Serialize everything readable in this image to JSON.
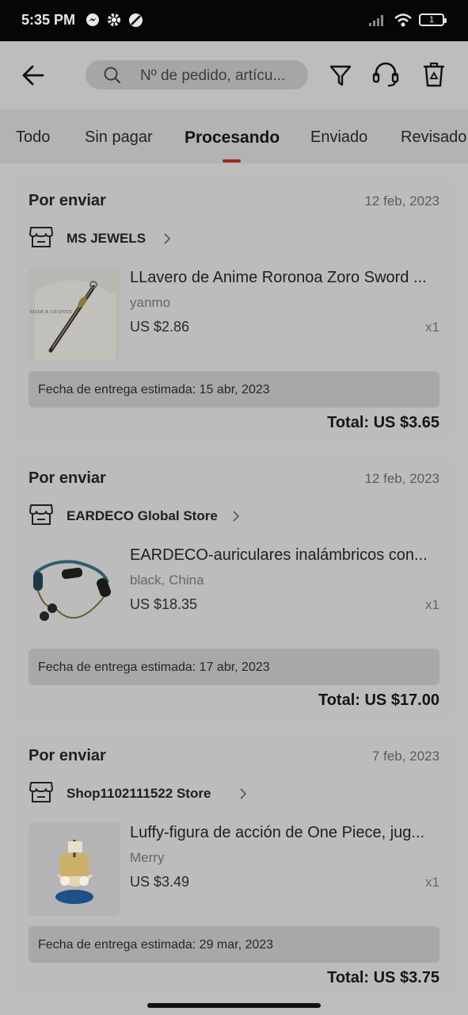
{
  "status_bar": {
    "time": "5:35 PM",
    "battery": "1",
    "icons": [
      "messenger-icon",
      "settings-icon",
      "no-disturb-icon",
      "signal-icon",
      "wifi-icon",
      "battery-icon"
    ]
  },
  "header": {
    "search_placeholder": "Nº de pedido, artícu...",
    "icons": [
      "back-arrow-icon",
      "search-icon",
      "filter-icon",
      "headset-icon",
      "trash-icon"
    ]
  },
  "tabs": [
    {
      "label": "Todo",
      "active": false
    },
    {
      "label": "Sin pagar",
      "active": false
    },
    {
      "label": "Procesando",
      "active": true
    },
    {
      "label": "Enviado",
      "active": false
    },
    {
      "label": "Revisado",
      "active": false
    }
  ],
  "orders": [
    {
      "status": "Por enviar",
      "date": "12 feb, 2023",
      "store": "MS JEWELS",
      "title": "LLavero de Anime Roronoa Zoro Sword ...",
      "variant": "yanmo",
      "price": "US $2.86",
      "qty": "x1",
      "delivery": "Fecha de entrega estimada: 15 abr, 2023",
      "total": "Total: US $3.65"
    },
    {
      "status": "Por enviar",
      "date": "12 feb, 2023",
      "store": "EARDECO Global Store",
      "title": "EARDECO-auriculares inalámbricos con...",
      "variant": "black, China",
      "price": "US $18.35",
      "qty": "x1",
      "delivery": "Fecha de entrega estimada: 17 abr, 2023",
      "total": "Total: US $17.00"
    },
    {
      "status": "Por enviar",
      "date": "7 feb, 2023",
      "store": "Shop1102111522 Store",
      "title": "Luffy-figura de acción de One Piece, jug...",
      "variant": "Merry",
      "price": "US $3.49",
      "qty": "x1",
      "delivery": "Fecha de entrega estimada: 29 mar, 2023",
      "total": "Total: US $3.75"
    }
  ],
  "colors": {
    "overlay_background": "#bdbdbd",
    "tab_indicator": "#9b2a1f",
    "status_bar": "#060606"
  }
}
